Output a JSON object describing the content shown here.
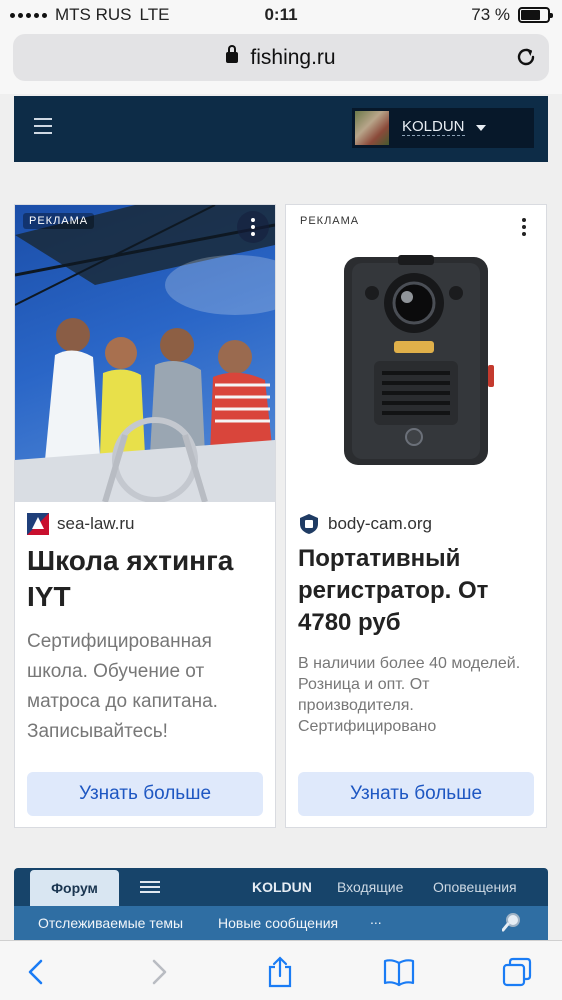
{
  "status_bar": {
    "carrier": "MTS RUS",
    "network": "LTE",
    "time": "0:11",
    "battery": "73 %",
    "battery_level": 0.73
  },
  "browser": {
    "url": "fishing.ru"
  },
  "site_header": {
    "username": "KOLDUN"
  },
  "ads": [
    {
      "badge": "РЕКЛАМА",
      "domain": "sea-law.ru",
      "title": "Школа яхтинга IYT",
      "description": "Сертифицированная школа. Обучение от матроса до капитана. Записывайтесь!",
      "cta": "Узнать больше"
    },
    {
      "badge": "РЕКЛАМА",
      "domain": "body-cam.org",
      "title": "Портативный регистратор. От 4780 руб",
      "description": "В наличии более 40 моделей. Розница и опт. От производителя. Сертифицировано",
      "cta": "Узнать больше"
    }
  ],
  "forum_nav": {
    "tab_forum": "Форум",
    "user": "KOLDUN",
    "inbox": "Входящие",
    "alerts": "Оповещения",
    "watched_threads": "Отслеживаемые темы",
    "new_posts": "Новые сообщения",
    "more": "..."
  },
  "colors": {
    "header_bg": "#0d2c47",
    "forum_bar": "#17446a",
    "forum_sub": "#2f6ea3",
    "cta_bg": "#dfe9fb",
    "cta_text": "#1e57c2",
    "ios_blue": "#1a7cf5"
  }
}
